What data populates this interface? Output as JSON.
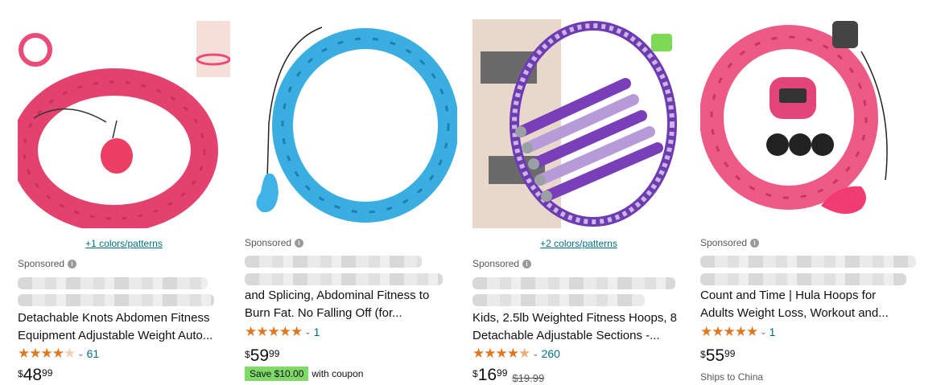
{
  "products": [
    {
      "colors_link": "+1 colors/patterns",
      "sponsored": "Sponsored",
      "title_line1": "Detachable Knots Abdomen Fitness",
      "title_line2": "Equipment Adjustable Weight Auto...",
      "rating": 4.0,
      "review_count": "61",
      "price_symbol": "$",
      "price_whole": "48",
      "price_fraction": "99"
    },
    {
      "sponsored": "Sponsored",
      "title_line1": "and Splicing, Abdominal Fitness to",
      "title_line2": "Burn Fat. No Falling Off (for...",
      "rating": 5.0,
      "review_count": "1",
      "price_symbol": "$",
      "price_whole": "59",
      "price_fraction": "99",
      "save_badge": "Save $10.00",
      "save_text": "with coupon"
    },
    {
      "colors_link": "+2 colors/patterns",
      "sponsored": "Sponsored",
      "title_line1": "Kids, 2.5lb Weighted Fitness Hoops, 8",
      "title_line2": "Detachable Adjustable Sections -...",
      "rating": 4.5,
      "review_count": "260",
      "price_symbol": "$",
      "price_whole": "16",
      "price_fraction": "99",
      "old_price": "$19.99"
    },
    {
      "sponsored": "Sponsored",
      "title_line1": "Count and Time | Hula Hoops for",
      "title_line2": "Adults Weight Loss, Workout and...",
      "rating": 5.0,
      "review_count": "1",
      "price_symbol": "$",
      "price_whole": "55",
      "price_fraction": "99",
      "ships_text": "Ships to China"
    }
  ],
  "icons": {
    "info": "info-icon",
    "chevron": "chevron-down-icon",
    "star": "star-icon"
  },
  "colors": {
    "star": "#de7921",
    "link": "#007185",
    "save_badge": "#7fda69",
    "hoop_pink": "#ec4a78",
    "hoop_blue": "#3aaee0",
    "hoop_purple": "#7a3fb8"
  }
}
